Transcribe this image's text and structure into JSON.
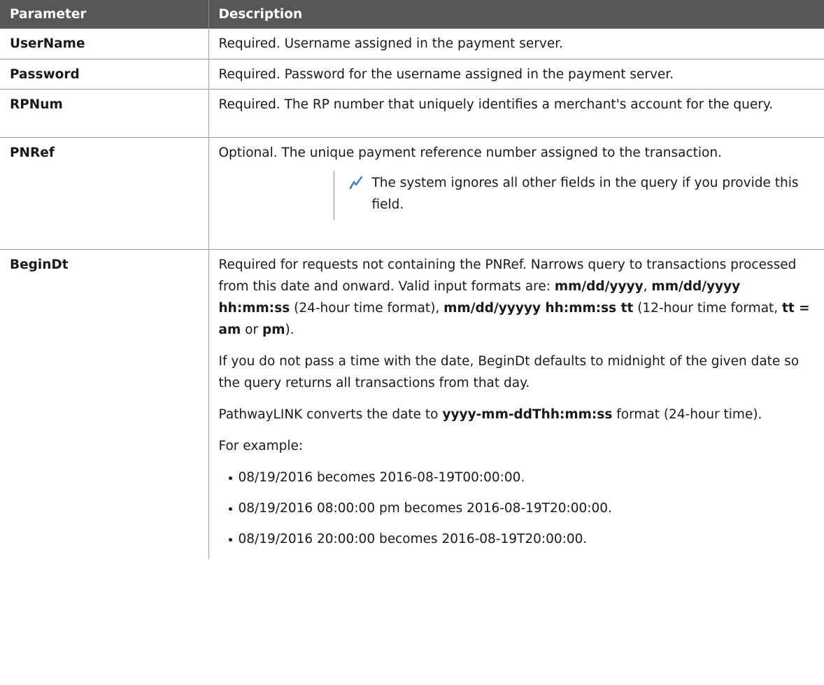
{
  "table": {
    "headers": [
      "Parameter",
      "Description"
    ],
    "rows": {
      "username": {
        "name": "UserName",
        "desc": "Required. Username assigned in the payment server."
      },
      "password": {
        "name": "Password",
        "desc": "Required. Password for the username assigned in the payment server."
      },
      "rpnum": {
        "name": "RPNum",
        "desc": "Required. The RP number that uniquely identifies a merchant's account for the query."
      },
      "pnref": {
        "name": "PNRef",
        "desc": "Optional. The unique payment reference number assigned to the transaction.",
        "note_icon": "pencil-note-icon",
        "note": "The system ignores all other fields in the query if you provide this field."
      },
      "begindt": {
        "name": "BeginDt",
        "p1": {
          "t1": "Required for requests not containing the PNRef. Narrows query to transactions processed from this date and onward. Valid input formats are: ",
          "b1": "mm/dd/yyyy",
          "t2": ", ",
          "b2": "mm/dd/yyyy hh:mm:ss",
          "t3": " (24-hour time format), ",
          "b3": "mm/dd/yyyyy hh:mm:ss tt",
          "t4": " (12-hour time format, ",
          "b4": "tt = am",
          "t5": " or ",
          "b5": "pm",
          "t6": ")."
        },
        "p2": "If you do not pass a time with the date, BeginDt defaults to midnight of the given date so the query returns all transactions from that day.",
        "p3": {
          "t1": "PathwayLINK converts the date to ",
          "b1": "yyyy-mm-ddThh:mm:ss",
          "t2": " format (24-hour time)."
        },
        "p4": "For example:",
        "examples": [
          "08/19/2016 becomes 2016-08-19T00:00:00.",
          "08/19/2016 08:00:00 pm becomes 2016-08-19T20:00:00.",
          "08/19/2016 20:00:00 becomes 2016-08-19T20:00:00."
        ]
      }
    }
  },
  "colors": {
    "header_bg": "#575757",
    "header_text": "#ffffff",
    "border": "#9e9e9e",
    "note_icon": "#2f6fd6"
  }
}
